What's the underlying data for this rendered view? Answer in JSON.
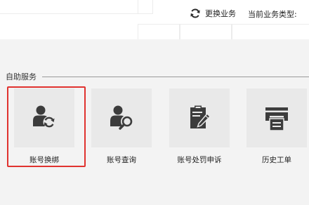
{
  "header": {
    "switch_business_label": "更换业务",
    "current_type_label": "当前业务类型:"
  },
  "section": {
    "title": "自助服务"
  },
  "services": [
    {
      "label": "账号换绑",
      "icon": "user-sync-icon",
      "highlighted": true
    },
    {
      "label": "账号查询",
      "icon": "user-search-icon",
      "highlighted": false
    },
    {
      "label": "账号处罚申诉",
      "icon": "clipboard-pen-icon",
      "highlighted": false
    },
    {
      "label": "历史工单",
      "icon": "printer-tray-icon",
      "highlighted": false
    }
  ],
  "colors": {
    "icon": "#3c3c3c",
    "highlight_border": "#e0322f",
    "panel_background": "#f3f3f3",
    "tile_background": "#e9e9e9"
  }
}
